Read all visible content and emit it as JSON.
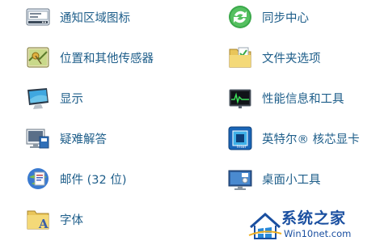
{
  "control_panel": {
    "left_column": [
      {
        "label": "通知区域图标",
        "icon": "notification-area-icon"
      },
      {
        "label": "位置和其他传感器",
        "icon": "location-sensors-icon"
      },
      {
        "label": "显示",
        "icon": "display-icon"
      },
      {
        "label": "疑难解答",
        "icon": "troubleshooting-icon"
      },
      {
        "label": "邮件 (32 位)",
        "icon": "mail-icon"
      },
      {
        "label": "字体",
        "icon": "fonts-icon"
      }
    ],
    "right_column": [
      {
        "label": "同步中心",
        "icon": "sync-center-icon"
      },
      {
        "label": "文件夹选项",
        "icon": "folder-options-icon"
      },
      {
        "label": "性能信息和工具",
        "icon": "performance-tools-icon"
      },
      {
        "label": "英特尔® 核芯显卡",
        "icon": "intel-graphics-icon"
      },
      {
        "label": "桌面小工具",
        "icon": "desktop-gadgets-icon"
      }
    ]
  },
  "watermark": {
    "title": "系统之家",
    "url": "Win10net.com"
  },
  "colors": {
    "link_text": "#1e5e8a",
    "watermark": "#1a4fa0"
  }
}
